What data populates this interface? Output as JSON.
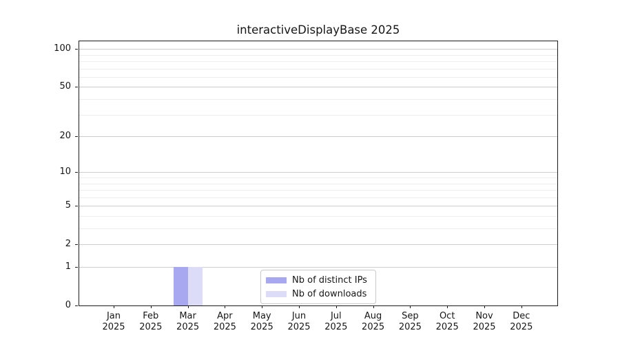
{
  "chart_data": {
    "type": "bar",
    "title": "interactiveDisplayBase 2025",
    "categories": [
      "Jan",
      "Feb",
      "Mar",
      "Apr",
      "May",
      "Jun",
      "Jul",
      "Aug",
      "Sep",
      "Oct",
      "Nov",
      "Dec"
    ],
    "year_label": "2025",
    "series": [
      {
        "name": "Nb of distinct IPs",
        "color": "#a8a8f0",
        "values": [
          0,
          0,
          1,
          0,
          0,
          0,
          0,
          0,
          0,
          0,
          0,
          0
        ]
      },
      {
        "name": "Nb of downloads",
        "color": "#dcdcf8",
        "values": [
          0,
          0,
          1,
          0,
          0,
          0,
          0,
          0,
          0,
          0,
          0,
          0
        ]
      }
    ],
    "y_scale": "log1p",
    "ylim": [
      0,
      115
    ],
    "y_major_ticks": [
      0,
      1,
      2,
      5,
      10,
      20,
      50,
      100
    ],
    "y_minor_gridlines": [
      3,
      4,
      6,
      7,
      8,
      9,
      30,
      40,
      60,
      70,
      80,
      90
    ],
    "grid": true,
    "legend_position": "lower center",
    "colors": {
      "grid_major": "#cdcdcd",
      "grid_minor": "#ededed",
      "spine": "#1b1b1b",
      "text": "#151515",
      "background": "#ffffff"
    }
  }
}
